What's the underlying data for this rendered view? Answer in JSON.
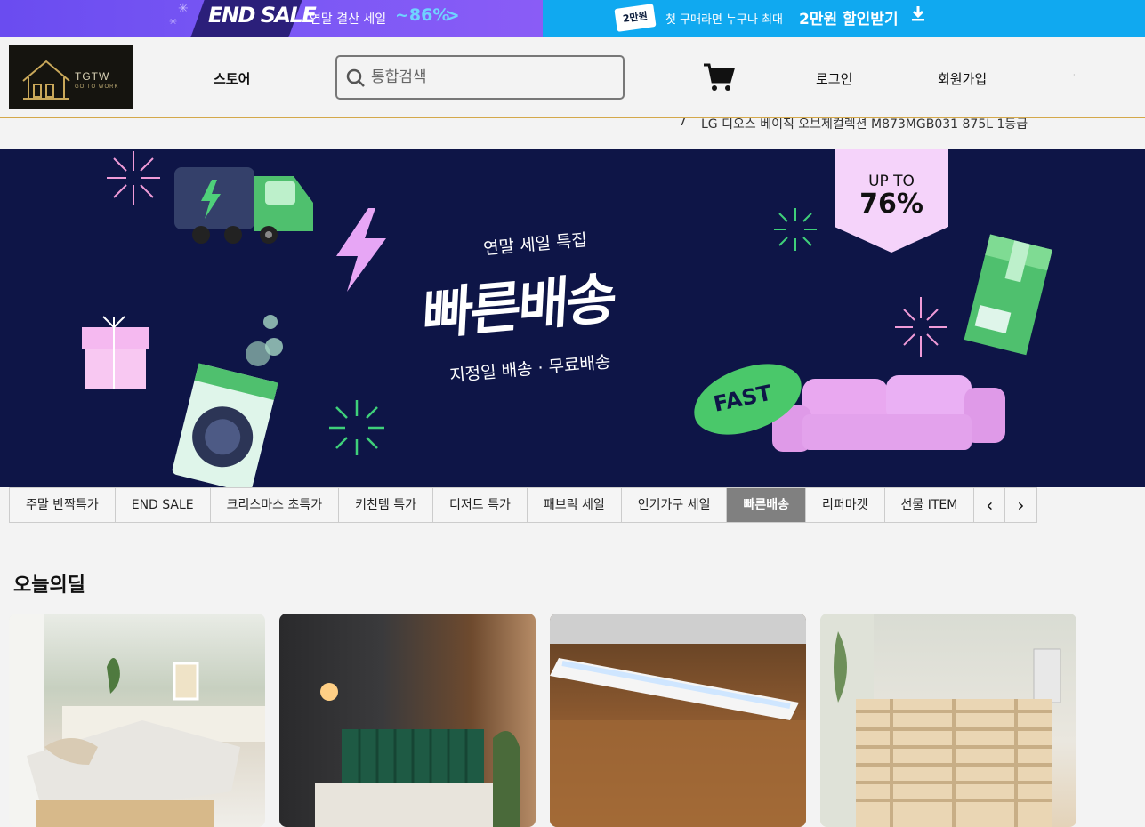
{
  "promo": {
    "left": {
      "badge": "END SALE",
      "text": "연말 결산 세일",
      "discount": "~86%"
    },
    "right": {
      "coupon_tag": "2만원",
      "text": "첫 구매라면 누구나 최대",
      "highlight": "2만원 할인받기"
    }
  },
  "header": {
    "logo_brand": "TGTW",
    "logo_sub": "GO TO WORK",
    "nav_store": "스토어",
    "search_placeholder": "통합검색",
    "login": "로그인",
    "signup": "회원가입",
    "dot": "·"
  },
  "ticker": {
    "rank": "7",
    "item": "LG 디오스 베이직 오브제컬렉션 M873MGB031 875L 1등급"
  },
  "banner": {
    "subtitle": "연말 세일 특집",
    "headline": "빠른배송",
    "tagline": "지정일 배송 · 무료배송",
    "upto_label": "UP TO",
    "upto_value": "76%",
    "fast_label": "FAST"
  },
  "tabs": [
    {
      "label": "주말 반짝특가",
      "active": false
    },
    {
      "label": "END SALE",
      "active": false
    },
    {
      "label": "크리스마스 초특가",
      "active": false
    },
    {
      "label": "키친템 특가",
      "active": false
    },
    {
      "label": "디저트 특가",
      "active": false
    },
    {
      "label": "패브릭 세일",
      "active": false
    },
    {
      "label": "인기가구 세일",
      "active": false
    },
    {
      "label": "빠른배송",
      "active": true
    },
    {
      "label": "리퍼마켓",
      "active": false
    },
    {
      "label": "선물 ITEM",
      "active": false
    }
  ],
  "arrows": {
    "prev": "‹",
    "next": "›"
  },
  "section": {
    "title": "오늘의딜"
  },
  "colors": {
    "promo_left": "#7b58f5",
    "promo_right": "#10a9f0",
    "banner_bg": "#0e1547",
    "active_tab": "#808080",
    "ticker_border": "#d4a84a"
  }
}
